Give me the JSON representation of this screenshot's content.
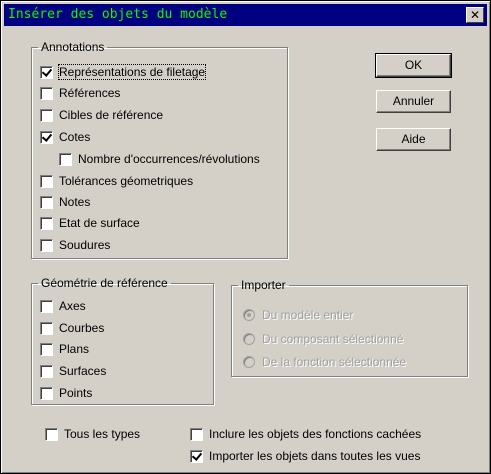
{
  "window": {
    "title": "Insérer des objets du modèle",
    "close_label": "✕"
  },
  "annotations": {
    "legend": "Annotations",
    "items": [
      {
        "label": "Représentations de filetage",
        "checked": true
      },
      {
        "label": "Références",
        "checked": false
      },
      {
        "label": "Cibles de référence",
        "checked": false
      },
      {
        "label": "Cotes",
        "checked": true
      },
      {
        "label": "Nombre d'occurrences/révolutions",
        "checked": false
      },
      {
        "label": "Tolérances géometriques",
        "checked": false
      },
      {
        "label": "Notes",
        "checked": false
      },
      {
        "label": "Etat de surface",
        "checked": false
      },
      {
        "label": "Soudures",
        "checked": false
      }
    ]
  },
  "geometry": {
    "legend": "Géométrie de référence",
    "items": [
      {
        "label": "Axes",
        "checked": false
      },
      {
        "label": "Courbes",
        "checked": false
      },
      {
        "label": "Plans",
        "checked": false
      },
      {
        "label": "Surfaces",
        "checked": false
      },
      {
        "label": "Points",
        "checked": false
      }
    ]
  },
  "import": {
    "legend": "Importer",
    "options": [
      {
        "label": "Du modèle entier",
        "selected": true
      },
      {
        "label": "Du composant sélectionné",
        "selected": false
      },
      {
        "label": "De la fonction sélectionnée",
        "selected": false
      }
    ]
  },
  "buttons": {
    "ok": "OK",
    "cancel": "Annuler",
    "help": "Aide"
  },
  "bottom": {
    "all_types": {
      "label": "Tous les types",
      "checked": false
    },
    "hidden_features": {
      "label": "Inclure les objets des fonctions cachées",
      "checked": false
    },
    "all_views": {
      "label": "Importer les objets dans toutes les vues",
      "checked": true
    }
  },
  "colors": {
    "titlebar": "#000080",
    "title_text": "#00ff00",
    "dialog_face": "#d4d0c8"
  }
}
